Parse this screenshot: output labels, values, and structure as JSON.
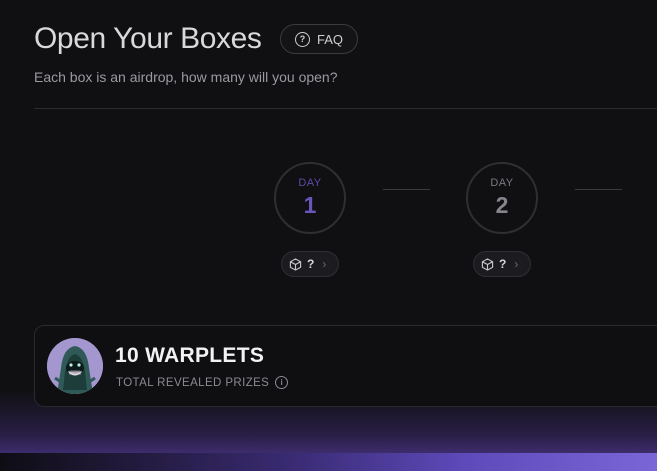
{
  "header": {
    "title": "Open Your Boxes",
    "faq_label": "FAQ",
    "subtitle": "Each box is an airdrop, how many will you open?"
  },
  "days": [
    {
      "label": "DAY",
      "number": "1",
      "box_count": "?"
    },
    {
      "label": "DAY",
      "number": "2",
      "box_count": "?"
    }
  ],
  "prizes": {
    "title": "10 WARPLETS",
    "subtitle": "TOTAL REVEALED PRIZES"
  },
  "colors": {
    "background": "#101012",
    "accent": "#6a55bd",
    "glow": "#7a66d6"
  },
  "icons": {
    "faq": "question-circle-icon",
    "box": "cube-icon",
    "chip_arrow": "chevron-right-icon",
    "info": "info-icon"
  }
}
